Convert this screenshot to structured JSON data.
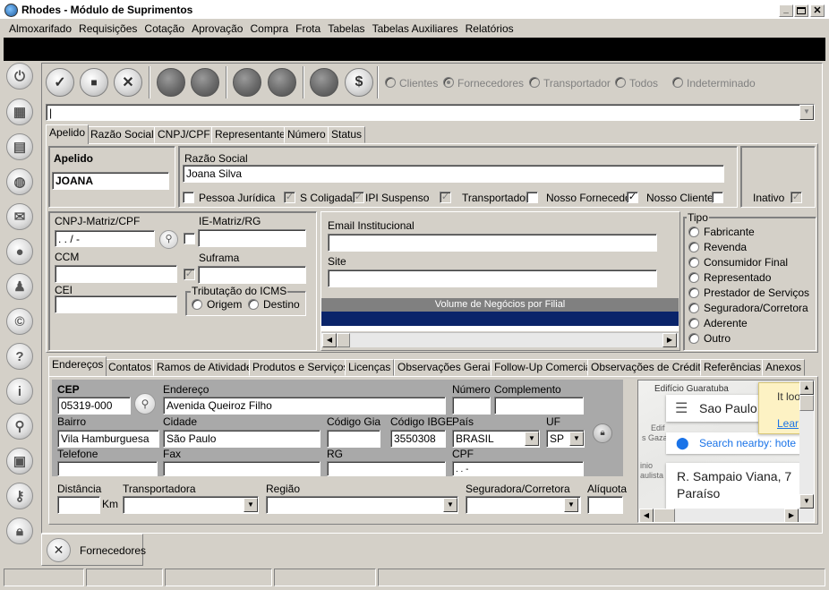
{
  "window": {
    "title": "Rhodes - Módulo de Suprimentos"
  },
  "menu": [
    "Almoxarifado",
    "Requisições",
    "Cotação",
    "Aprovação",
    "Compra",
    "Frota",
    "Tabelas",
    "Tabelas Auxiliares",
    "Relatórios"
  ],
  "toolbar": {
    "confirm_icon": "✓",
    "new_icon": "■",
    "cancel_icon": "✕",
    "money_icon": "$",
    "radios": [
      "Clientes",
      "Fornecedores",
      "Transportador",
      "Todos",
      "Indeterminado"
    ],
    "radio_selected": "Fornecedores"
  },
  "search_tabs": [
    "Apelido",
    "Razão Social",
    "CNPJ/CPF",
    "Representante",
    "Número",
    "Status"
  ],
  "form": {
    "apelido_label": "Apelido",
    "apelido": "JOANA",
    "razao_label": "Razão Social",
    "razao": "Joana Silva",
    "pessoa_juridica": "Pessoa Jurídica",
    "s_coligada": "S Coligada",
    "ipi_suspenso": "IPI Suspenso",
    "transportador": "Transportador",
    "nosso_fornecedor": "Nosso Fornecedor",
    "nosso_cliente": "Nosso Cliente",
    "inativo": "Inativo",
    "cnpj_label": "CNPJ-Matriz/CPF",
    "cnpj": "  .   .   /   -",
    "ie_label": "IE-Matriz/RG",
    "ccm_label": "CCM",
    "suframa_label": "Suframa",
    "cei_label": "CEI",
    "icms_label": "Tributação do ICMS",
    "origem": "Origem",
    "destino": "Destino",
    "email_label": "Email Institucional",
    "site_label": "Site",
    "volume_header": "Volume de Negócios por Filial",
    "tipo_label": "Tipo",
    "tipos": [
      "Fabricante",
      "Revenda",
      "Consumidor Final",
      "Representado",
      "Prestador de Serviços",
      "Seguradora/Corretora",
      "Aderente",
      "Outro"
    ]
  },
  "detail_tabs": [
    "Endereços",
    "Contatos",
    "Ramos de Atividade",
    "Produtos e Serviços",
    "Licenças",
    "Observações Gerais",
    "Follow-Up Comercial",
    "Observações de Crédito",
    "Referências",
    "Anexos"
  ],
  "address": {
    "cep_label": "CEP",
    "cep": "05319-000",
    "endereco_label": "Endereço",
    "endereco": "Avenida Queiroz Filho",
    "numero_label": "Número",
    "complemento_label": "Complemento",
    "bairro_label": "Bairro",
    "bairro": "Vila Hamburguesa",
    "cidade_label": "Cidade",
    "cidade": "São Paulo",
    "gia_label": "Código Gia",
    "ibge_label": "Código IBGE",
    "ibge": "3550308",
    "pais_label": "País",
    "pais": "BRASIL",
    "uf_label": "UF",
    "uf": "SP",
    "telefone_label": "Telefone",
    "fax_label": "Fax",
    "rg_label": "RG",
    "cpf_label": "CPF",
    "cpf": ".    .    -",
    "distancia_label": "Distância",
    "km": "Km",
    "transportadora_label": "Transportadora",
    "regiao_label": "Região",
    "seguradora_label": "Seguradora/Corretora",
    "aliquota_label": "Alíquota"
  },
  "map": {
    "place_top": "Edifício Guaratuba",
    "search_text": "Sao Paulo",
    "nearby": "Search nearby: hote",
    "address_line1": "R. Sampaio Viana, 7",
    "address_line2": "Paraíso",
    "popup_line1": "It loo",
    "popup_line2": "Lear",
    "label_edif": "Edif",
    "label_gazal": "s Gazal",
    "label_inio": "inio",
    "label_aulista": "aulista"
  },
  "bottom_tab": {
    "label": "Fornecedores"
  }
}
